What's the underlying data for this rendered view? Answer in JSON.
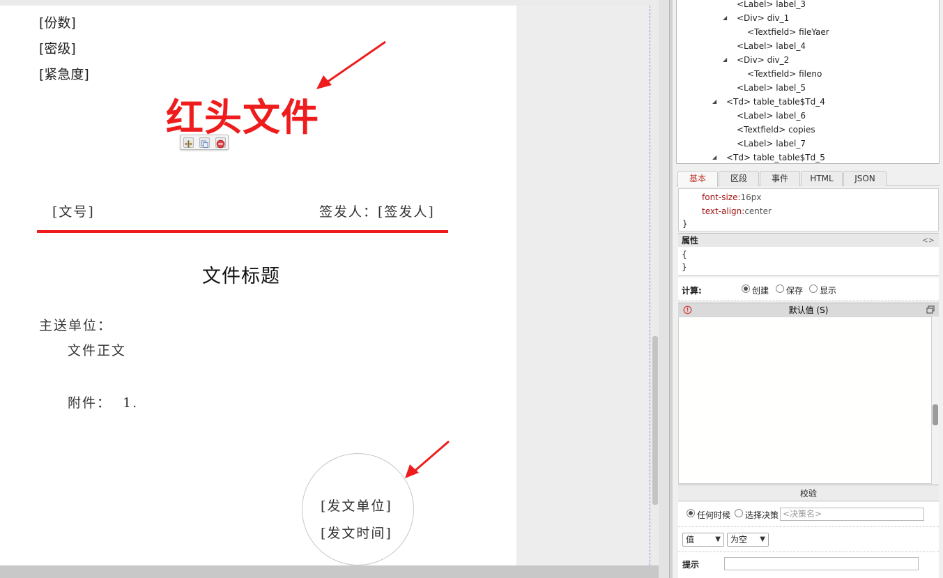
{
  "document": {
    "copies_label": "[份数]",
    "secrecy_label": "[密级]",
    "urgency_label": "[紧急度]",
    "red_header": "红头文件",
    "doc_number": "[文号]",
    "signer": "签发人：[签发人]",
    "title": "文件标题",
    "recipient": "主送单位：",
    "body": "文件正文",
    "attachment": "附件：  1.",
    "issuer": "[发文单位]",
    "issue_time": "[发文时间]",
    "accent_color": "#ee1c1c"
  },
  "float_toolbar": {
    "move_icon": "move-icon",
    "copy_icon": "copy-icon",
    "delete_icon": "delete-icon"
  },
  "tree": {
    "nodes": [
      {
        "label": "<Label> label_3",
        "toggle": ""
      },
      {
        "label": "<Div> div_1",
        "toggle": "◢"
      },
      {
        "label": "<Textfield> fileYaer",
        "toggle": ""
      },
      {
        "label": "<Label> label_4",
        "toggle": ""
      },
      {
        "label": "<Div> div_2",
        "toggle": "◢"
      },
      {
        "label": "<Textfield> fileno",
        "toggle": ""
      },
      {
        "label": "<Label> label_5",
        "toggle": ""
      },
      {
        "label": "<Td> table_table$Td_4",
        "toggle": "◢"
      },
      {
        "label": "<Label> label_6",
        "toggle": ""
      },
      {
        "label": "<Textfield> copies",
        "toggle": ""
      },
      {
        "label": "<Label> label_7",
        "toggle": ""
      },
      {
        "label": "<Td> table_table$Td_5",
        "toggle": "◢"
      }
    ]
  },
  "tabs": [
    {
      "label": "基本",
      "active": true
    },
    {
      "label": "区段"
    },
    {
      "label": "事件"
    },
    {
      "label": "HTML"
    },
    {
      "label": "JSON"
    }
  ],
  "css": {
    "rules": [
      {
        "prop": "font-size",
        "value": "16px"
      },
      {
        "prop": "text-align",
        "value": "center"
      }
    ],
    "close_brace": "}"
  },
  "attributes": {
    "heading": "属性",
    "code_toggle": "<>",
    "open_brace": "{",
    "close_brace": "}"
  },
  "calc": {
    "label": "计算:",
    "options": [
      "创建",
      "保存",
      "显示"
    ],
    "selected": "创建"
  },
  "default_value": {
    "heading": "默认值 (S)",
    "info_icon": "info-icon",
    "window_icon": "window-icon"
  },
  "verify": {
    "heading": "校验",
    "timing_options": [
      "任何时候",
      "选择决策"
    ],
    "timing_selected": "任何时候",
    "decision_placeholder": "<决策名>",
    "value_select": "值",
    "empty_select": "为空",
    "hint_label": "提示",
    "hint_value": ""
  }
}
